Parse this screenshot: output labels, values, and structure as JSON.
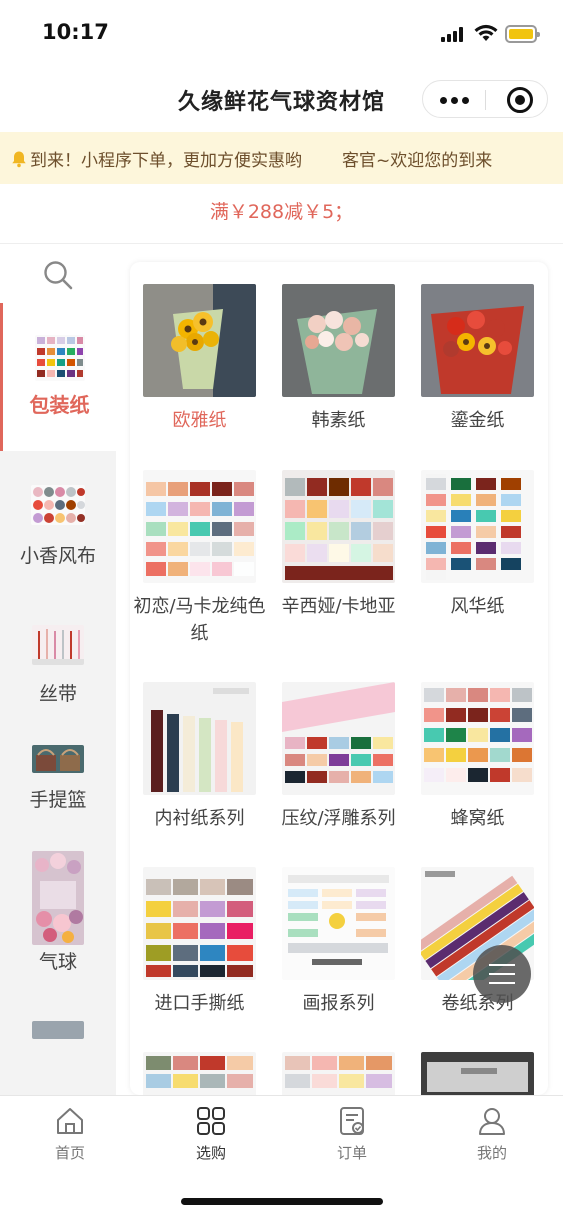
{
  "status_bar": {
    "time": "10:17"
  },
  "nav": {
    "title": "久缘鲜花气球资材馆"
  },
  "notice": {
    "text": "到来！小程序下单，更加方便实惠哟",
    "text2": "客官~欢迎您的到来"
  },
  "promo": {
    "text": "满￥288减￥5；"
  },
  "sidebar": {
    "items": [
      {
        "label": "包装纸"
      },
      {
        "label": "小香风布"
      },
      {
        "label": "丝带"
      },
      {
        "label": "手提篮"
      },
      {
        "label": "气球"
      }
    ]
  },
  "grid": {
    "items": [
      {
        "label": "欧雅纸"
      },
      {
        "label": "韩素纸"
      },
      {
        "label": "鎏金纸"
      },
      {
        "label": "初恋/马卡龙纯色纸"
      },
      {
        "label": "辛西娅/卡地亚"
      },
      {
        "label": "风华纸"
      },
      {
        "label": "内衬纸系列"
      },
      {
        "label": "压纹/浮雕系列"
      },
      {
        "label": "蜂窝纸"
      },
      {
        "label": "进口手撕纸"
      },
      {
        "label": "画报系列"
      },
      {
        "label": "卷纸系列"
      }
    ]
  },
  "tabbar": {
    "items": [
      {
        "label": "首页",
        "icon": "home-icon"
      },
      {
        "label": "选购",
        "icon": "grid-icon"
      },
      {
        "label": "订单",
        "icon": "order-icon"
      },
      {
        "label": "我的",
        "icon": "user-icon"
      }
    ]
  },
  "colors": {
    "accent": "#e0675b",
    "notice_bg": "#fdf6db",
    "sidebar_bg": "#f3f3f3"
  }
}
